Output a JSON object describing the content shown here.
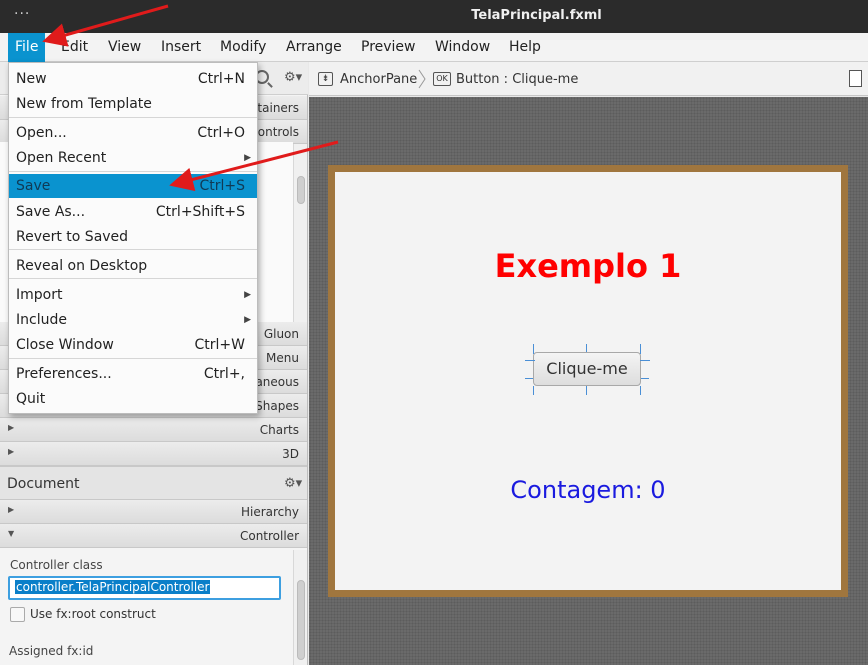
{
  "window": {
    "dots": "···",
    "title": "TelaPrincipal.fxml"
  },
  "menubar": {
    "items": [
      {
        "label": "File"
      },
      {
        "label": "Edit"
      },
      {
        "label": "View"
      },
      {
        "label": "Insert"
      },
      {
        "label": "Modify"
      },
      {
        "label": "Arrange"
      },
      {
        "label": "Preview"
      },
      {
        "label": "Window"
      },
      {
        "label": "Help"
      }
    ]
  },
  "file_menu": {
    "new": {
      "label": "New",
      "shortcut": "Ctrl+N"
    },
    "new_template": {
      "label": "New from Template"
    },
    "open": {
      "label": "Open...",
      "shortcut": "Ctrl+O"
    },
    "open_recent": {
      "label": "Open Recent"
    },
    "save": {
      "label": "Save",
      "shortcut": "Ctrl+S"
    },
    "save_as": {
      "label": "Save As...",
      "shortcut": "Ctrl+Shift+S"
    },
    "revert": {
      "label": "Revert to Saved"
    },
    "reveal": {
      "label": "Reveal on Desktop"
    },
    "import": {
      "label": "Import"
    },
    "include": {
      "label": "Include"
    },
    "close": {
      "label": "Close Window",
      "shortcut": "Ctrl+W"
    },
    "prefs": {
      "label": "Preferences...",
      "shortcut": "Ctrl+,"
    },
    "quit": {
      "label": "Quit"
    }
  },
  "library": {
    "sections_partial": {
      "containers": "tainers",
      "controls": "ontrols"
    },
    "sections": {
      "gluon": "Gluon",
      "menu": "Menu",
      "misc": "aneous",
      "shapes": "Shapes",
      "charts": "Charts",
      "three_d": "3D"
    }
  },
  "document": {
    "title": "Document",
    "hierarchy": "Hierarchy",
    "controller": "Controller",
    "controller_class_label": "Controller class",
    "controller_class_value": "controller.TelaPrincipalController",
    "fx_root_label": "Use fx:root construct",
    "assigned_fxid_label": "Assigned fx:id"
  },
  "breadcrumb": {
    "root": "AnchorPane",
    "button_icon": "OK",
    "current": "Button : Clique-me"
  },
  "preview": {
    "heading": "Exemplo 1",
    "button_label": "Clique-me",
    "counter": "Contagem: 0",
    "heading_color": "#ff0000",
    "counter_color": "#1a1adf",
    "frame_color": "#a0763e"
  },
  "colors": {
    "accent": "#0a93cf",
    "annotation": "#e01b1b"
  },
  "icons": [
    "search-icon",
    "gear-icon",
    "anchor-pane-icon",
    "button-icon",
    "document-icon",
    "triangle-right-icon",
    "triangle-down-icon",
    "submenu-arrow-icon"
  ]
}
